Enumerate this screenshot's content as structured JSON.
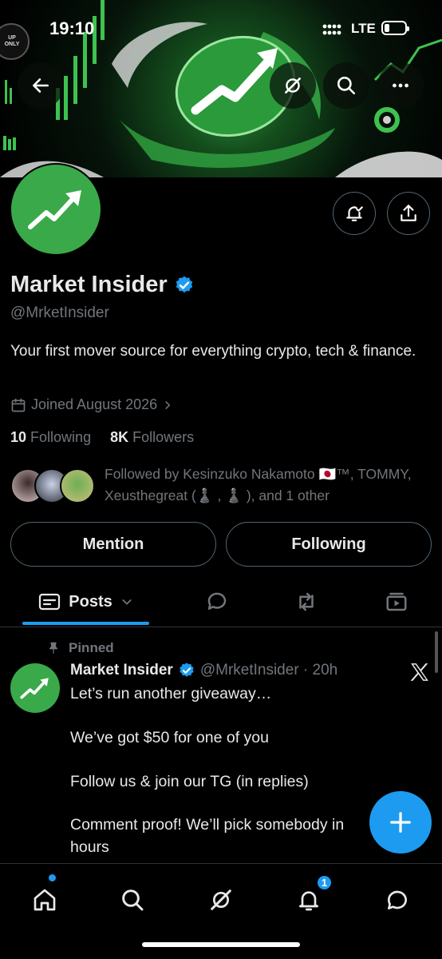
{
  "status_bar": {
    "time": "19:10",
    "network": "LTE"
  },
  "banner": {
    "badge_text": "UP ONLY"
  },
  "profile": {
    "display_name": "Market Insider",
    "handle": "@MrketInsider",
    "bio": "Your first mover source for everything crypto, tech & finance.",
    "joined": "Joined August 2026",
    "following_count": "10",
    "following_label": "Following",
    "followers_count": "8K",
    "followers_label": "Followers",
    "followed_by": "Followed by Kesinzuko Nakamoto 🇯🇵™, TOMMY, Xeusthegreat (♟️ , ♟️ ), and 1 other"
  },
  "actions": {
    "mention_label": "Mention",
    "following_label": "Following"
  },
  "tabs": {
    "posts_label": "Posts"
  },
  "tweet": {
    "pinned_label": "Pinned",
    "author": "Market Insider",
    "handle_time": "@MrketInsider · 20h",
    "lines": [
      "Let’s run another giveaway…",
      "We’ve got $50 for one of you",
      "Follow us & join our TG (in replies)",
      "Comment proof! We’ll pick somebody in",
      "hours"
    ]
  },
  "bottom_nav": {
    "notifications_badge": "1"
  },
  "colors": {
    "accent": "#1d9bf0",
    "brand_green": "#3aa94a",
    "muted": "#71767b"
  }
}
